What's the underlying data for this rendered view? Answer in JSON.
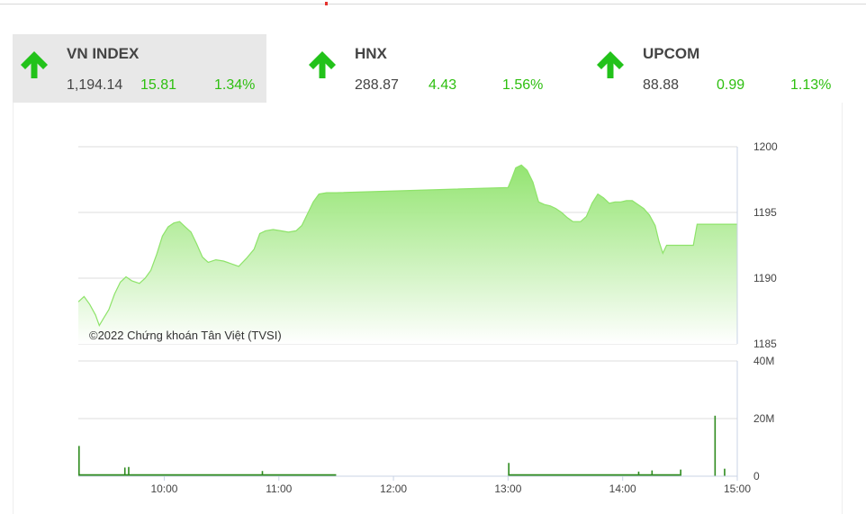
{
  "tabs": [
    {
      "name": "VN INDEX",
      "value": "1,194.14",
      "change": "15.81",
      "pct": "1.34%",
      "active": true
    },
    {
      "name": "HNX",
      "value": "288.87",
      "change": "4.43",
      "pct": "1.56%",
      "active": false
    },
    {
      "name": "UPCOM",
      "value": "88.88",
      "change": "0.99",
      "pct": "1.13%",
      "active": false
    }
  ],
  "colors": {
    "up": "#2dbf0f",
    "arrow": "#22c21a",
    "line": "#8ee36a",
    "area_top": "#8ee36a",
    "area_bottom": "#ffffff",
    "volume": "#2e8b1e",
    "grid": "#dddddd",
    "axis": "#c8d3e6"
  },
  "icons": {
    "tab_arrow": "up-arrow-icon"
  },
  "chart_data": {
    "type": "area",
    "credit": "©2022 Chứng khoán Tân Việt (TVSI)",
    "x_ticks": [
      "10:00",
      "11:00",
      "12:00",
      "13:00",
      "14:00",
      "15:00"
    ],
    "x_range": [
      "09:15",
      "15:00"
    ],
    "price": {
      "y_ticks": [
        "1200",
        "1195",
        "1190",
        "1185"
      ],
      "ylim": [
        1185,
        1200
      ],
      "points": [
        [
          "09:15",
          1188.2
        ],
        [
          "09:18",
          1188.6
        ],
        [
          "09:21",
          1188.0
        ],
        [
          "09:24",
          1187.2
        ],
        [
          "09:26",
          1186.4
        ],
        [
          "09:28",
          1186.9
        ],
        [
          "09:31",
          1187.6
        ],
        [
          "09:34",
          1188.8
        ],
        [
          "09:37",
          1189.7
        ],
        [
          "09:40",
          1190.1
        ],
        [
          "09:43",
          1189.8
        ],
        [
          "09:47",
          1189.6
        ],
        [
          "09:50",
          1190.0
        ],
        [
          "09:53",
          1190.6
        ],
        [
          "09:56",
          1191.8
        ],
        [
          "09:59",
          1193.2
        ],
        [
          "10:02",
          1193.9
        ],
        [
          "10:05",
          1194.2
        ],
        [
          "10:08",
          1194.3
        ],
        [
          "10:11",
          1193.9
        ],
        [
          "10:14",
          1193.5
        ],
        [
          "10:17",
          1192.6
        ],
        [
          "10:20",
          1191.6
        ],
        [
          "10:23",
          1191.2
        ],
        [
          "10:27",
          1191.4
        ],
        [
          "10:31",
          1191.3
        ],
        [
          "10:35",
          1191.1
        ],
        [
          "10:39",
          1190.9
        ],
        [
          "10:43",
          1191.5
        ],
        [
          "10:47",
          1192.2
        ],
        [
          "10:50",
          1193.4
        ],
        [
          "10:53",
          1193.6
        ],
        [
          "10:57",
          1193.7
        ],
        [
          "11:01",
          1193.6
        ],
        [
          "11:05",
          1193.5
        ],
        [
          "11:09",
          1193.6
        ],
        [
          "11:12",
          1194.0
        ],
        [
          "11:15",
          1194.9
        ],
        [
          "11:18",
          1195.8
        ],
        [
          "11:21",
          1196.4
        ],
        [
          "11:25",
          1196.5
        ],
        [
          "11:29",
          1196.5
        ],
        [
          "11:30",
          1196.5
        ],
        [
          "13:00",
          1196.9
        ],
        [
          "13:02",
          1197.6
        ],
        [
          "13:04",
          1198.4
        ],
        [
          "13:07",
          1198.6
        ],
        [
          "13:10",
          1198.2
        ],
        [
          "13:13",
          1197.3
        ],
        [
          "13:16",
          1195.8
        ],
        [
          "13:19",
          1195.6
        ],
        [
          "13:22",
          1195.5
        ],
        [
          "13:25",
          1195.3
        ],
        [
          "13:28",
          1195.0
        ],
        [
          "13:31",
          1194.6
        ],
        [
          "13:34",
          1194.3
        ],
        [
          "13:38",
          1194.3
        ],
        [
          "13:41",
          1194.7
        ],
        [
          "13:44",
          1195.7
        ],
        [
          "13:47",
          1196.4
        ],
        [
          "13:50",
          1196.1
        ],
        [
          "13:53",
          1195.7
        ],
        [
          "13:56",
          1195.8
        ],
        [
          "13:59",
          1195.8
        ],
        [
          "14:02",
          1195.9
        ],
        [
          "14:05",
          1195.9
        ],
        [
          "14:08",
          1195.6
        ],
        [
          "14:11",
          1195.3
        ],
        [
          "14:14",
          1194.8
        ],
        [
          "14:17",
          1194.0
        ],
        [
          "14:19",
          1192.8
        ],
        [
          "14:21",
          1191.9
        ],
        [
          "14:23",
          1192.5
        ],
        [
          "14:25",
          1192.5
        ],
        [
          "14:30",
          1192.5
        ],
        [
          "14:35",
          1192.5
        ],
        [
          "14:37",
          1192.5
        ],
        [
          "14:39",
          1194.1
        ],
        [
          "14:45",
          1194.1
        ],
        [
          "15:00",
          1194.1
        ]
      ]
    },
    "volume": {
      "y_ticks": [
        "40M",
        "20M",
        "0"
      ],
      "ylim": [
        0,
        40
      ],
      "unit": "M",
      "spikes": [
        [
          "09:15",
          10.5
        ],
        [
          "09:39",
          3.0
        ],
        [
          "09:41",
          3.2
        ],
        [
          "10:51",
          1.8
        ],
        [
          "13:00",
          4.6
        ],
        [
          "14:08",
          1.6
        ],
        [
          "14:15",
          2.0
        ],
        [
          "14:30",
          2.3
        ],
        [
          "14:48",
          21.0
        ],
        [
          "14:53",
          2.6
        ]
      ],
      "baseline_sessions": [
        [
          "09:15",
          "11:30"
        ],
        [
          "13:00",
          "14:30"
        ]
      ],
      "baseline_level": 0.7
    }
  }
}
